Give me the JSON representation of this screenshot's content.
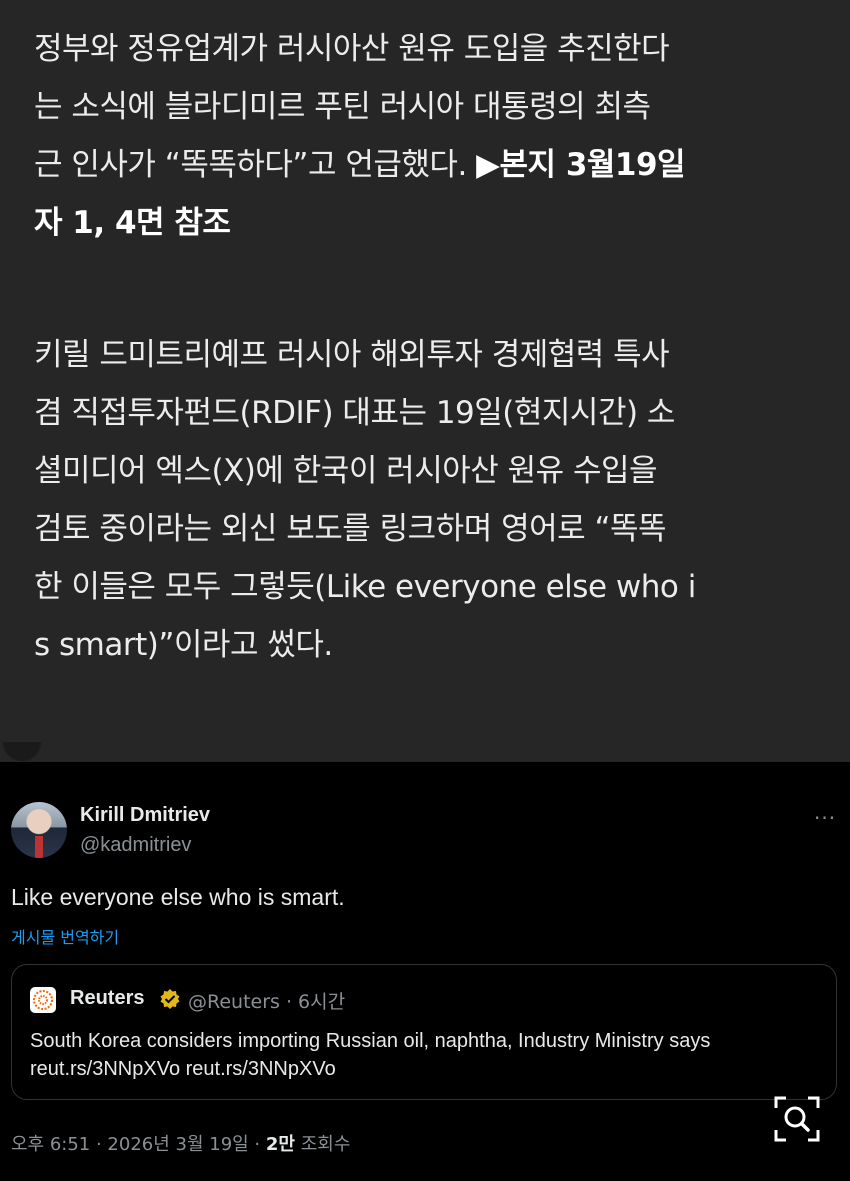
{
  "article": {
    "paragraph1": "정부와 정유업계가 러시아산 원유 도입을 추진한다\n는 소식에 블라디미르 푸틴 러시아 대통령의 최측\n근 인사가 “똑똑하다”고 언급했다.",
    "paragraph1_ref": "▶본지 3월19일\n자 1, 4면 참조",
    "paragraph2": "키릴 드미트리예프 러시아 해외투자 경제협력 특사\n겸 직접투자펀드(RDIF) 대표는 19일(현지시간) 소\n셜미디어 엑스(X)에 한국이 러시아산 원유 수입을\n검토 중이라는 외신 보도를 링크하며 영어로 “똑똑\n한 이들은 모두 그렇듯(Like everyone else who i\ns smart)”이라고 썼다."
  },
  "tweet": {
    "author_name": "Kirill Dmitriev",
    "author_handle": "@kadmitriev",
    "more_label": "···",
    "text": "Like everyone else who is smart.",
    "translate_label": "게시물 번역하기",
    "quote": {
      "name": "Reuters",
      "handle_time": "@Reuters · 6시간",
      "text": "South Korea considers importing Russian oil, naphtha, Industry Ministry says reut.rs/3NNpXVo reut.rs/3NNpXVo"
    },
    "footer": {
      "time_date": "오후 6:51 · 2026년 3월 19일 · ",
      "views_count": "2만",
      "views_label": " 조회수"
    }
  },
  "colors": {
    "article_bg": "#262626",
    "tweet_bg": "#000000",
    "link_blue": "#1d9bf0",
    "verified_gold": "#e2b719",
    "reuters_orange": "#fa6400"
  },
  "icons": [
    "avatar",
    "more-icon",
    "reuters-logo-icon",
    "verified-badge-icon",
    "lens-search-icon"
  ]
}
